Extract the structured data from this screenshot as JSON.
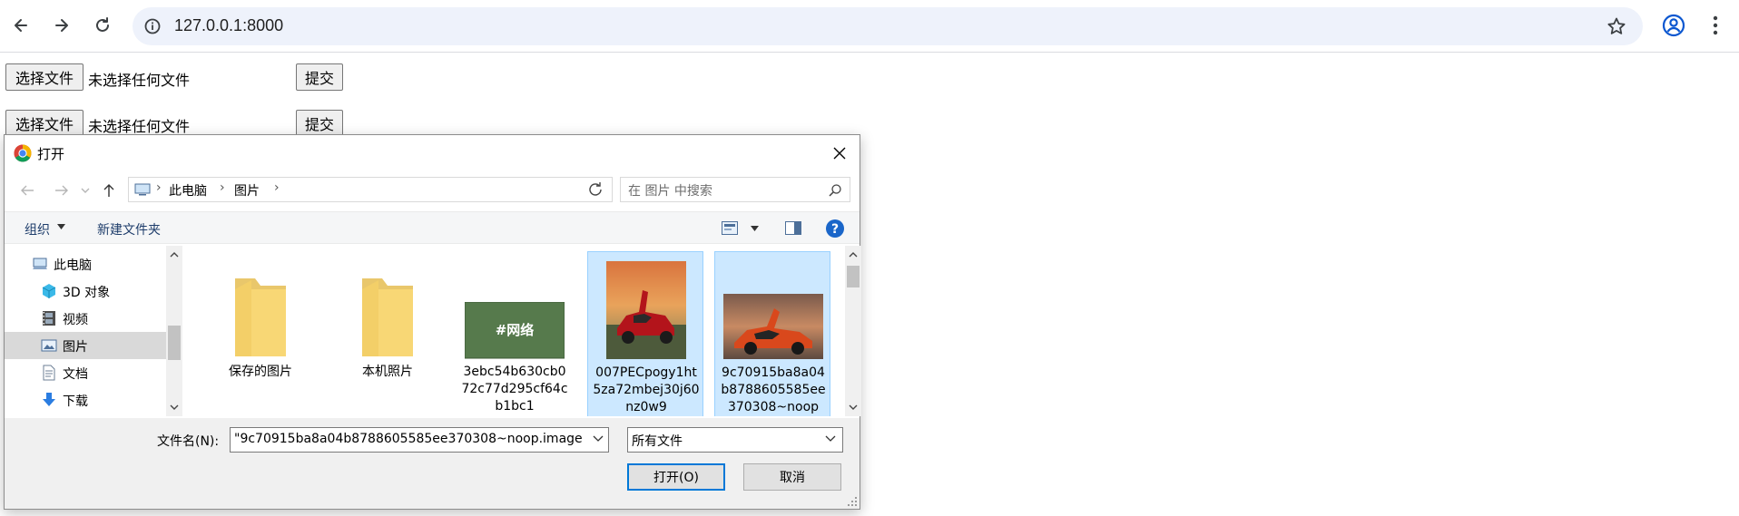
{
  "browser": {
    "url": "127.0.0.1:8000"
  },
  "page": {
    "forms": [
      {
        "choose_label": "选择文件",
        "status": "未选择任何文件",
        "submit_label": "提交"
      },
      {
        "choose_label": "选择文件",
        "status": "未选择任何文件",
        "submit_label": "提交"
      }
    ]
  },
  "dialog": {
    "title": "打开",
    "breadcrumb": [
      "此电脑",
      "图片"
    ],
    "search_placeholder": "在 图片 中搜索",
    "commands": {
      "organize": "组织",
      "new_folder": "新建文件夹"
    },
    "help_glyph": "?",
    "nav_items": [
      {
        "label": "此电脑",
        "icon": "computer-icon"
      },
      {
        "label": "3D 对象",
        "icon": "3d-objects-icon"
      },
      {
        "label": "视频",
        "icon": "video-icon"
      },
      {
        "label": "图片",
        "icon": "pictures-icon",
        "selected": true
      },
      {
        "label": "文档",
        "icon": "documents-icon"
      },
      {
        "label": "下载",
        "icon": "download-icon"
      }
    ],
    "files": [
      {
        "label": "保存的图片",
        "kind": "folder",
        "selected": false
      },
      {
        "label": "本机照片",
        "kind": "folder",
        "selected": false
      },
      {
        "label": "3ebc54b630cb072c77d295cf64cb1bc1",
        "kind": "image",
        "thumb_text": "#网络",
        "selected": false
      },
      {
        "label": "007PECpogy1ht5za72mbej30j60nz0w9",
        "kind": "image",
        "selected": true
      },
      {
        "label": "9c70915ba8a04b8788605585ee370308~noop",
        "kind": "image",
        "selected": true
      }
    ],
    "filename_label": "文件名(N):",
    "filename_value": "\"9c70915ba8a04b8788605585ee370308~noop.image",
    "filetype_value": "所有文件",
    "open_label": "打开(O)",
    "cancel_label": "取消"
  },
  "colors": {
    "omnibox_bg": "#eef2fb",
    "selection_bg": "#cce8ff",
    "accent": "#0078d7"
  }
}
